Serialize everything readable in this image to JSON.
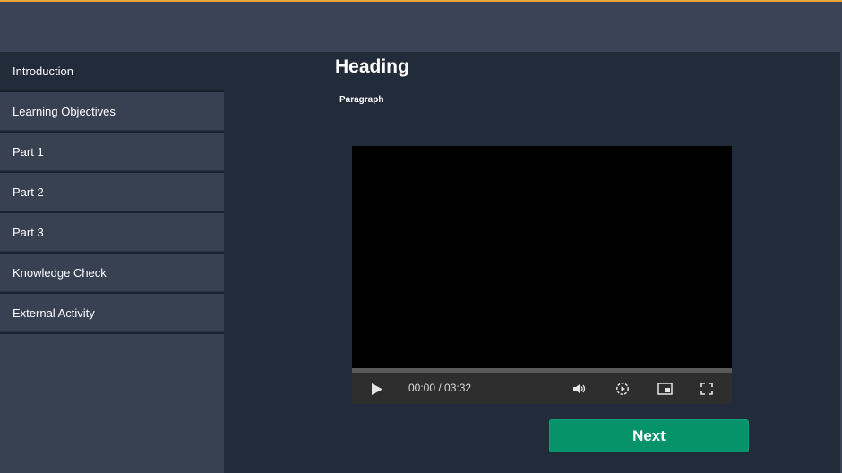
{
  "nav": {
    "items": [
      {
        "label": "Introduction"
      },
      {
        "label": "Learning Objectives"
      },
      {
        "label": "Part 1"
      },
      {
        "label": "Part 2"
      },
      {
        "label": "Part 3"
      },
      {
        "label": "Knowledge Check"
      },
      {
        "label": "External Activity"
      }
    ],
    "active": "Introduction"
  },
  "content": {
    "heading": "Heading",
    "paragraph": "Paragraph"
  },
  "video": {
    "current_time": "00:00",
    "duration": "03:32",
    "time_display": "00:00 / 03:32",
    "progress": 0,
    "icons": [
      "play-icon",
      "volume-icon",
      "playback-speed-icon",
      "picture-in-picture-icon",
      "fullscreen-icon"
    ]
  },
  "buttons": {
    "next_label": "Next"
  },
  "colors": {
    "accent_top_border": "#e8a53a",
    "next_button": "#07936a",
    "sidebar": "#384152",
    "main_background": "#222b3a"
  }
}
